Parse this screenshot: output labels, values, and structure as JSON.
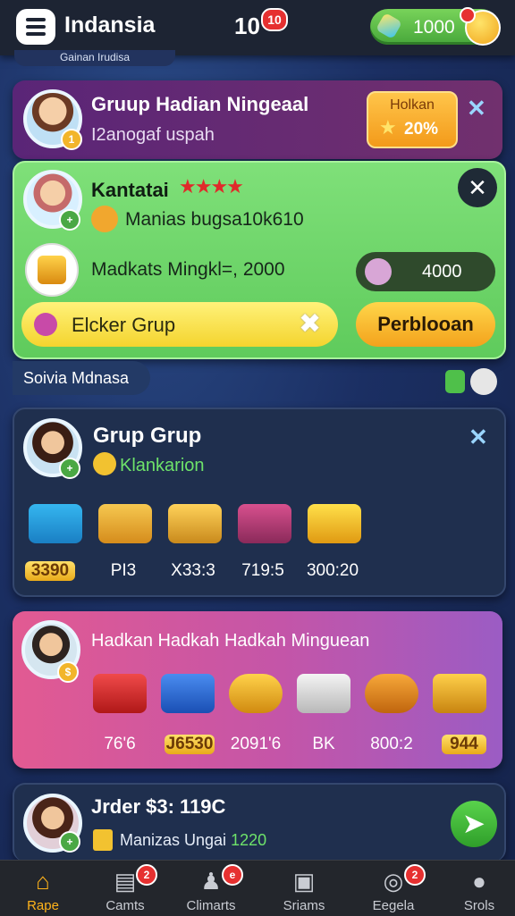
{
  "header": {
    "app_title": "Indansia",
    "level": "10",
    "level_badge": "10",
    "coins": "1000"
  },
  "hint_tab": "Gainan Irudisa",
  "card_group_invite": {
    "title": "Gruup Hadian Ningeaal",
    "subtitle": "I2anogaf uspah",
    "promo_label": "Holkan",
    "promo_value": "20%"
  },
  "card_kantatai": {
    "name": "Kantatai",
    "stars": "★★★★",
    "line1": "Manias bugsa10k610",
    "line2": "Madkats Mingkl=, 2000",
    "pill_value": "4000",
    "yellow_label": "Elcker Grup",
    "orange_button": "Perblooan"
  },
  "section_title": "Soivia Mdnasa",
  "card_grup": {
    "title": "Grup Grup",
    "subtitle": "Klankarion",
    "rewards": [
      {
        "icon": "gift-box-icon",
        "label": "3390"
      },
      {
        "icon": "toy-blocks-icon",
        "label": "PI​3"
      },
      {
        "icon": "block-tray-icon",
        "label": "X33:3"
      },
      {
        "icon": "truck-icon",
        "label": "719:5"
      },
      {
        "icon": "gold-gift-icon",
        "label": "300:20"
      }
    ]
  },
  "card_hadkan": {
    "title": "Hadkan Hadkah Hadkah Minguean",
    "rewards": [
      {
        "icon": "red-chest-icon",
        "label": "76'6"
      },
      {
        "icon": "gold-basket-icon",
        "label": "J6530"
      },
      {
        "icon": "coin-pot-icon",
        "label": "2091'6"
      },
      {
        "icon": "machine-icon",
        "label": "BK"
      },
      {
        "icon": "honey-pot-icon",
        "label": "800:2"
      },
      {
        "icon": "treasure-chest-icon",
        "label": "944"
      }
    ]
  },
  "card_jrder": {
    "title": "Jrder $3: 119C",
    "subtitle": "Manizas Ungai",
    "subtitle_value": "1220"
  },
  "nav": [
    {
      "label": "Rape",
      "icon": "home-icon",
      "badge": ""
    },
    {
      "label": "Camts",
      "icon": "cards-icon",
      "badge": "2"
    },
    {
      "label": "Climarts",
      "icon": "people-icon",
      "badge": "e"
    },
    {
      "label": "Sriams",
      "icon": "screen-icon",
      "badge": ""
    },
    {
      "label": "Eegela",
      "icon": "target-icon",
      "badge": "2"
    },
    {
      "label": "Srols",
      "icon": "profile-icon",
      "badge": ""
    }
  ],
  "colors": {
    "accent_green": "#5fcb5c",
    "accent_orange": "#f3a21c",
    "nav_active": "#ffb31a",
    "badge_red": "#e63030"
  }
}
